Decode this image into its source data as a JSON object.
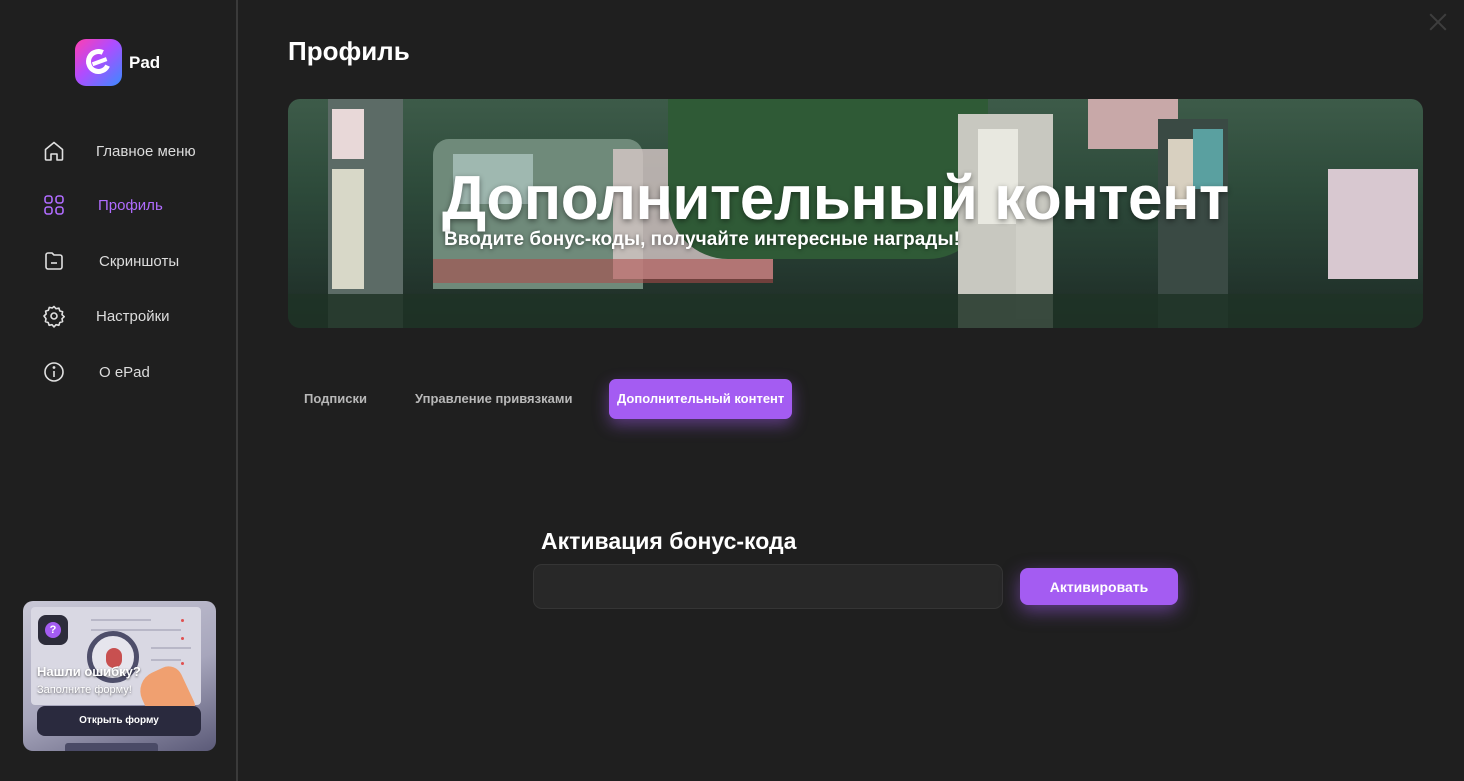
{
  "app": {
    "logo_text": "Pad",
    "close_icon": "close-icon"
  },
  "sidebar": {
    "items": [
      {
        "label": "Главное меню",
        "icon": "home-icon",
        "active": false
      },
      {
        "label": "Профиль",
        "icon": "grid-icon",
        "active": true
      },
      {
        "label": "Скриншоты",
        "icon": "folder-icon",
        "active": false
      },
      {
        "label": "Настройки",
        "icon": "gear-icon",
        "active": false
      },
      {
        "label": "О ePad",
        "icon": "info-icon",
        "active": false
      }
    ],
    "bug_card": {
      "title": "Нашли ошибку?",
      "subtitle": "Заполните форму!",
      "button_label": "Открыть форму",
      "icon": "question-icon"
    }
  },
  "main": {
    "page_title": "Профиль",
    "banner": {
      "title": "Дополнительный контент",
      "subtitle": "Вводите бонус-коды, получайте интересные награды!"
    },
    "tabs": [
      {
        "label": "Подписки",
        "active": false
      },
      {
        "label": "Управление привязками",
        "active": false
      },
      {
        "label": "Дополнительный контент",
        "active": true
      }
    ],
    "bonus": {
      "title": "Активация бонус-кода",
      "input_value": "",
      "input_placeholder": "",
      "button_label": "Активировать"
    }
  },
  "colors": {
    "accent": "#a45cf2",
    "background": "#1f1f1f",
    "input_bg": "#282828"
  }
}
